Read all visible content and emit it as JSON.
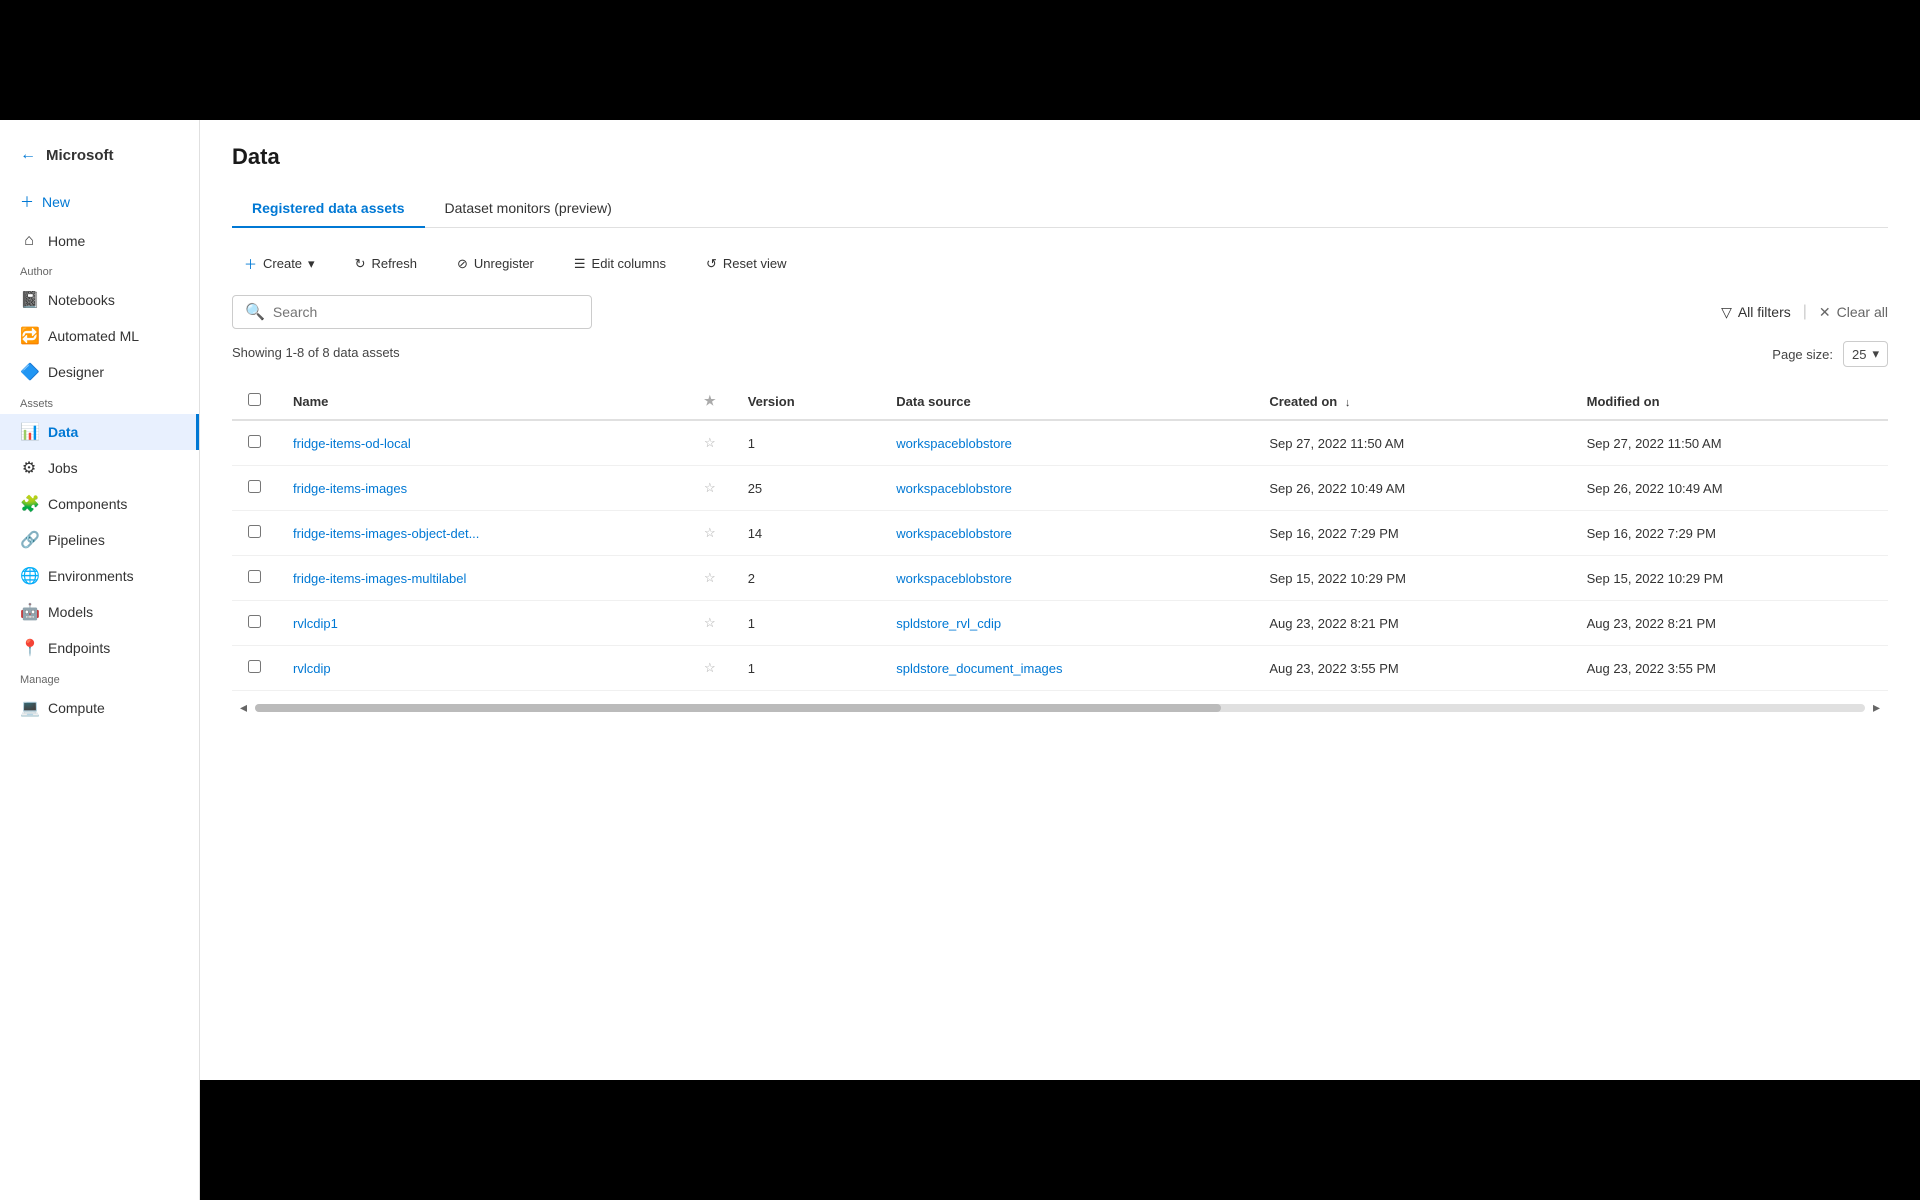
{
  "topbar": {
    "background": "#000000"
  },
  "sidebar": {
    "logo_text": "Microsoft",
    "back_icon": "←",
    "new_label": "New",
    "section_author": "Author",
    "section_assets": "Assets",
    "section_manage": "Manage",
    "items": [
      {
        "id": "new",
        "label": "New",
        "icon": "➕",
        "section": "top"
      },
      {
        "id": "home",
        "label": "Home",
        "icon": "⌂",
        "section": "top"
      },
      {
        "id": "notebooks",
        "label": "Notebooks",
        "icon": "📓",
        "section": "author"
      },
      {
        "id": "automated-ml",
        "label": "Automated ML",
        "icon": "🔁",
        "section": "author"
      },
      {
        "id": "designer",
        "label": "Designer",
        "icon": "🔷",
        "section": "author"
      },
      {
        "id": "data",
        "label": "Data",
        "icon": "📊",
        "section": "assets",
        "active": true
      },
      {
        "id": "jobs",
        "label": "Jobs",
        "icon": "⚙",
        "section": "assets"
      },
      {
        "id": "components",
        "label": "Components",
        "icon": "🧩",
        "section": "assets"
      },
      {
        "id": "pipelines",
        "label": "Pipelines",
        "icon": "🔗",
        "section": "assets"
      },
      {
        "id": "environments",
        "label": "Environments",
        "icon": "🌐",
        "section": "assets"
      },
      {
        "id": "models",
        "label": "Models",
        "icon": "🤖",
        "section": "assets"
      },
      {
        "id": "endpoints",
        "label": "Endpoints",
        "icon": "📍",
        "section": "assets"
      },
      {
        "id": "compute",
        "label": "Compute",
        "icon": "💻",
        "section": "manage"
      }
    ]
  },
  "header": {
    "title": "Data",
    "tabs": [
      {
        "id": "registered",
        "label": "Registered data assets",
        "active": true
      },
      {
        "id": "monitors",
        "label": "Dataset monitors (preview)",
        "active": false
      }
    ]
  },
  "toolbar": {
    "create_label": "Create",
    "create_icon": "+",
    "refresh_label": "Refresh",
    "refresh_icon": "↻",
    "unregister_label": "Unregister",
    "unregister_icon": "⊘",
    "edit_columns_label": "Edit columns",
    "edit_columns_icon": "☰",
    "reset_view_label": "Reset view",
    "reset_view_icon": "↺"
  },
  "search": {
    "placeholder": "Search",
    "icon": "🔍"
  },
  "filters": {
    "all_filters_label": "All filters",
    "all_filters_icon": "▽",
    "clear_all_label": "Clear all",
    "clear_icon": "✕"
  },
  "table": {
    "showing_text": "Showing 1-8 of 8 data assets",
    "page_size_label": "Page size:",
    "page_size_value": "25",
    "columns": [
      {
        "id": "name",
        "label": "Name",
        "sortable": true
      },
      {
        "id": "star",
        "label": "★",
        "sortable": false
      },
      {
        "id": "version",
        "label": "Version",
        "sortable": false
      },
      {
        "id": "data_source",
        "label": "Data source",
        "sortable": false
      },
      {
        "id": "created_on",
        "label": "Created on",
        "sortable": true,
        "sort_dir": "desc"
      },
      {
        "id": "modified_on",
        "label": "Modified on",
        "sortable": false
      }
    ],
    "rows": [
      {
        "name": "fridge-items-od-local",
        "version": "1",
        "data_source": "workspaceblobstore",
        "created_on": "Sep 27, 2022 11:50 AM",
        "modified_on": "Sep 27, 2022 11:50 AM"
      },
      {
        "name": "fridge-items-images",
        "version": "25",
        "data_source": "workspaceblobstore",
        "created_on": "Sep 26, 2022 10:49 AM",
        "modified_on": "Sep 26, 2022 10:49 AM"
      },
      {
        "name": "fridge-items-images-object-det...",
        "version": "14",
        "data_source": "workspaceblobstore",
        "created_on": "Sep 16, 2022 7:29 PM",
        "modified_on": "Sep 16, 2022 7:29 PM"
      },
      {
        "name": "fridge-items-images-multilabel",
        "version": "2",
        "data_source": "workspaceblobstore",
        "created_on": "Sep 15, 2022 10:29 PM",
        "modified_on": "Sep 15, 2022 10:29 PM"
      },
      {
        "name": "rvlcdip1",
        "version": "1",
        "data_source": "spldstore_rvl_cdip",
        "created_on": "Aug 23, 2022 8:21 PM",
        "modified_on": "Aug 23, 2022 8:21 PM"
      },
      {
        "name": "rvlcdip",
        "version": "1",
        "data_source": "spldstore_document_images",
        "created_on": "Aug 23, 2022 3:55 PM",
        "modified_on": "Aug 23, 2022 3:55 PM"
      }
    ]
  }
}
